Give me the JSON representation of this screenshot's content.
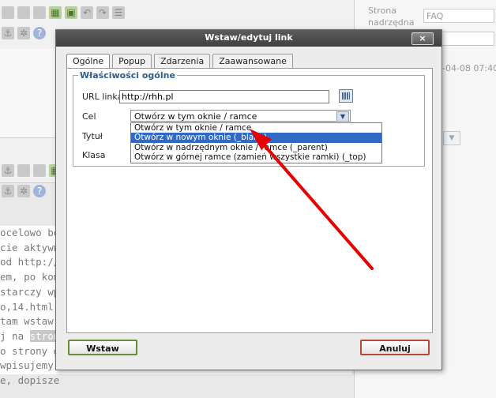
{
  "background": {
    "right_panel": {
      "label": "Strona nadrzędna",
      "value": "FAQ",
      "date": "-04-08 07:40"
    },
    "text_lines": [
      {
        "text": "ocelowo be"
      },
      {
        "text": "cie aktywny"
      },
      {
        "text": " od http://"
      },
      {
        "text": "em, po kom"
      },
      {
        "text": "starczy wp"
      },
      {
        "text": "o,14.html  "
      },
      {
        "text": " tam wstaw"
      },
      {
        "text": "j na "
      },
      {
        "text": "o strony gł"
      },
      {
        "text": " wpisujemy"
      },
      {
        "text": "e, dopisze"
      }
    ],
    "highlight_word": "stronie"
  },
  "dialog": {
    "title": "Wstaw/edytuj link",
    "close_label": "×",
    "tabs": [
      {
        "label": "Ogólne",
        "active": true
      },
      {
        "label": "Popup",
        "active": false
      },
      {
        "label": "Zdarzenia",
        "active": false
      },
      {
        "label": "Zaawansowane",
        "active": false
      }
    ],
    "section_title": "Właściwości ogólne",
    "url_label": "URL linka",
    "url_value": "http://rhh.pl",
    "target_label": "Cel",
    "target_selected": "Otwórz w tym oknie / ramce",
    "target_options": [
      "Otwórz w tym oknie / ramce",
      "Otwórz w nowym oknie (_blank)",
      "Otwórz w nadrzędnym oknie / ramce (_parent)",
      "Otwórz w górnej ramce (zamień wszystkie ramki) (_top)"
    ],
    "title_label": "Tytuł",
    "class_label": "Klasa",
    "insert_button": "Wstaw",
    "cancel_button": "Anuluj"
  },
  "colors": {
    "titlebar": "#4a4a4a",
    "selection": "#316ac5",
    "annotation_arrow": "#e60000"
  }
}
